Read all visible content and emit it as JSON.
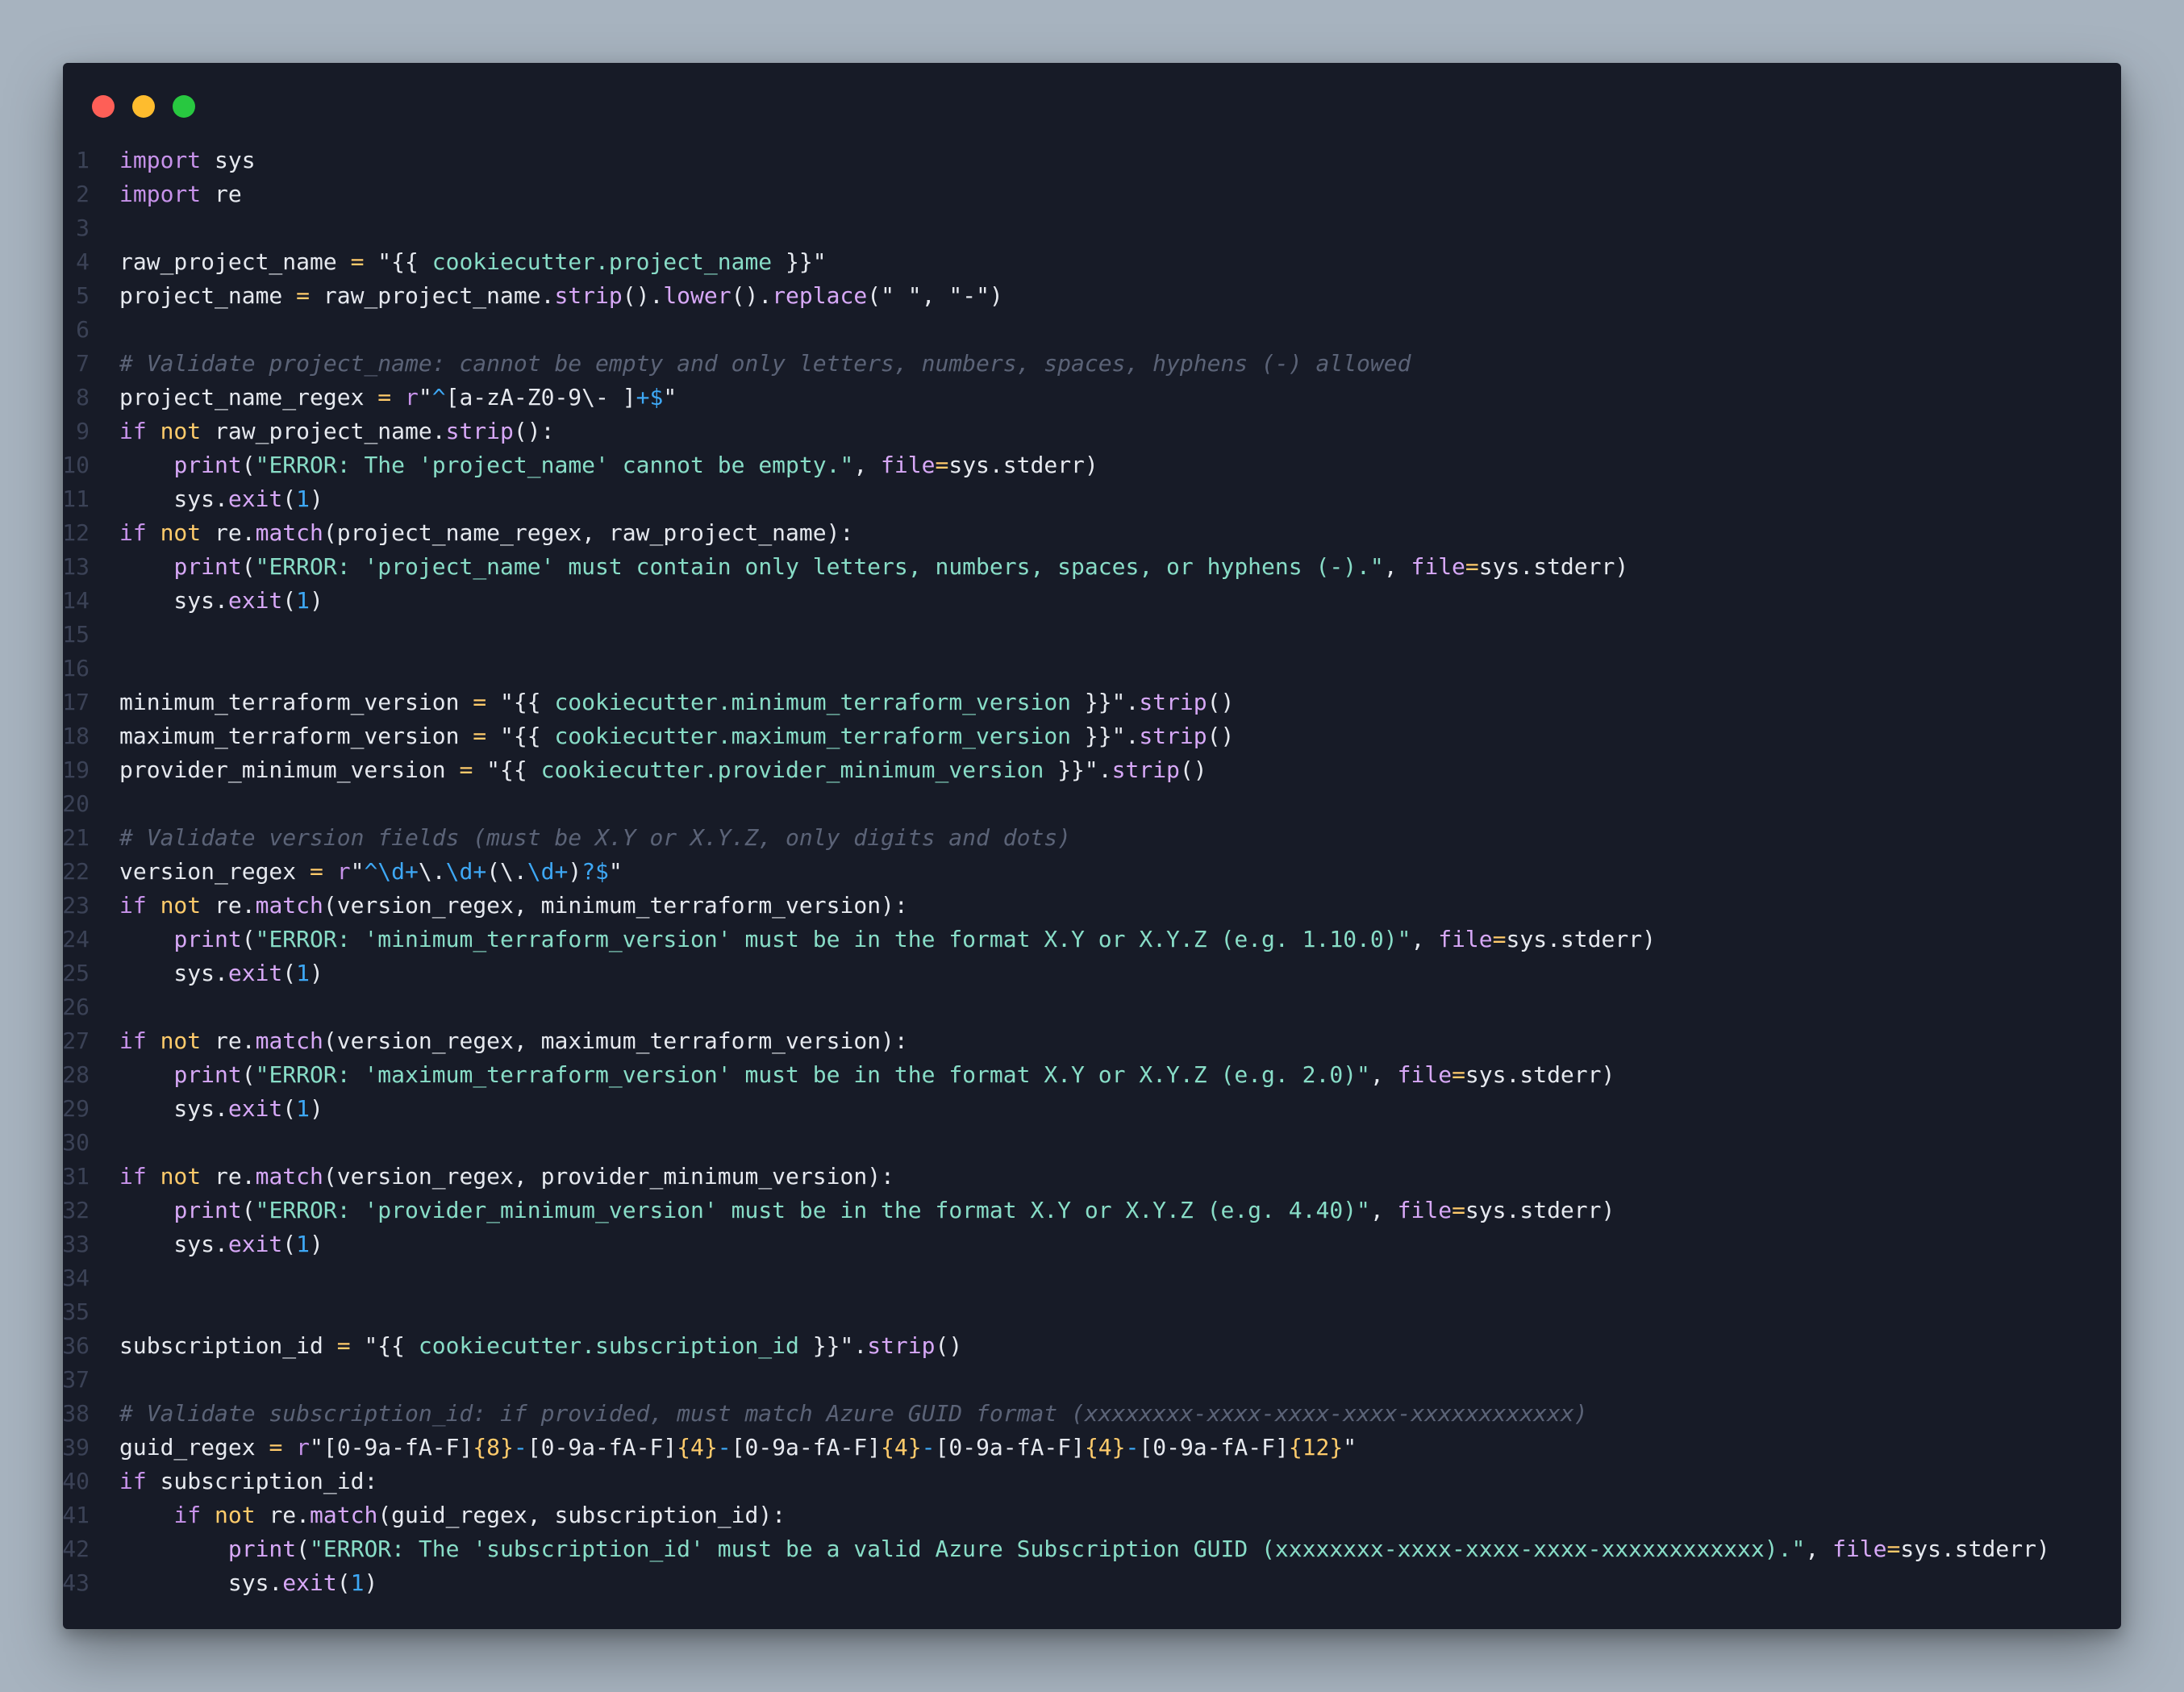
{
  "window": {
    "controls": [
      "close",
      "minimize",
      "maximize"
    ],
    "colors": {
      "close": "#fe5f57",
      "minimize": "#febc2e",
      "maximize": "#28c840",
      "background": "#171b27"
    }
  },
  "editor": {
    "language": "python",
    "lines": [
      {
        "n": "1",
        "tokens": [
          [
            "kw",
            "import"
          ],
          [
            "pl",
            " sys"
          ]
        ]
      },
      {
        "n": "2",
        "tokens": [
          [
            "kw",
            "import"
          ],
          [
            "pl",
            " re"
          ]
        ]
      },
      {
        "n": "3",
        "tokens": []
      },
      {
        "n": "4",
        "tokens": [
          [
            "pl",
            "raw_project_name "
          ],
          [
            "op",
            "="
          ],
          [
            "pl",
            " "
          ],
          [
            "strq",
            "\"{{"
          ],
          [
            "str",
            " cookiecutter.project_name "
          ],
          [
            "strq",
            "}}\""
          ]
        ]
      },
      {
        "n": "5",
        "tokens": [
          [
            "pl",
            "project_name "
          ],
          [
            "op",
            "="
          ],
          [
            "pl",
            " raw_project_name."
          ],
          [
            "fn",
            "strip"
          ],
          [
            "pl",
            "()."
          ],
          [
            "fn",
            "lower"
          ],
          [
            "pl",
            "()."
          ],
          [
            "fn",
            "replace"
          ],
          [
            "pl",
            "(\" \", \"-\")"
          ]
        ]
      },
      {
        "n": "6",
        "tokens": []
      },
      {
        "n": "7",
        "tokens": [
          [
            "cm",
            "# Validate project_name: cannot be empty and only letters, numbers, spaces, hyphens (-) allowed"
          ]
        ]
      },
      {
        "n": "8",
        "tokens": [
          [
            "pl",
            "project_name_regex "
          ],
          [
            "op",
            "="
          ],
          [
            "pl",
            " "
          ],
          [
            "kw",
            "r"
          ],
          [
            "strq",
            "\""
          ],
          [
            "rx",
            "^"
          ],
          [
            "strq",
            "[a-zA-Z0-9\\- ]"
          ],
          [
            "rx",
            "+$"
          ],
          [
            "strq",
            "\""
          ]
        ]
      },
      {
        "n": "9",
        "tokens": [
          [
            "kw",
            "if"
          ],
          [
            "pl",
            " "
          ],
          [
            "kw2",
            "not"
          ],
          [
            "pl",
            " raw_project_name."
          ],
          [
            "fn",
            "strip"
          ],
          [
            "pl",
            "():"
          ]
        ]
      },
      {
        "n": "10",
        "tokens": [
          [
            "pl",
            "    "
          ],
          [
            "fn",
            "print"
          ],
          [
            "pl",
            "("
          ],
          [
            "str",
            "\"ERROR: The 'project_name' cannot be empty.\""
          ],
          [
            "pl",
            ", "
          ],
          [
            "fn",
            "file"
          ],
          [
            "op",
            "="
          ],
          [
            "pl",
            "sys.stderr)"
          ]
        ]
      },
      {
        "n": "11",
        "tokens": [
          [
            "pl",
            "    sys."
          ],
          [
            "fn",
            "exit"
          ],
          [
            "pl",
            "("
          ],
          [
            "num",
            "1"
          ],
          [
            "pl",
            ")"
          ]
        ]
      },
      {
        "n": "12",
        "tokens": [
          [
            "kw",
            "if"
          ],
          [
            "pl",
            " "
          ],
          [
            "kw2",
            "not"
          ],
          [
            "pl",
            " re."
          ],
          [
            "fn",
            "match"
          ],
          [
            "pl",
            "(project_name_regex, raw_project_name):"
          ]
        ]
      },
      {
        "n": "13",
        "tokens": [
          [
            "pl",
            "    "
          ],
          [
            "fn",
            "print"
          ],
          [
            "pl",
            "("
          ],
          [
            "str",
            "\"ERROR: 'project_name' must contain only letters, numbers, spaces, or hyphens (-).\""
          ],
          [
            "pl",
            ", "
          ],
          [
            "fn",
            "file"
          ],
          [
            "op",
            "="
          ],
          [
            "pl",
            "sys.stderr)"
          ]
        ]
      },
      {
        "n": "14",
        "tokens": [
          [
            "pl",
            "    sys."
          ],
          [
            "fn",
            "exit"
          ],
          [
            "pl",
            "("
          ],
          [
            "num",
            "1"
          ],
          [
            "pl",
            ")"
          ]
        ]
      },
      {
        "n": "15",
        "tokens": []
      },
      {
        "n": "16",
        "tokens": []
      },
      {
        "n": "17",
        "tokens": [
          [
            "pl",
            "minimum_terraform_version "
          ],
          [
            "op",
            "="
          ],
          [
            "pl",
            " "
          ],
          [
            "strq",
            "\"{{"
          ],
          [
            "str",
            " cookiecutter.minimum_terraform_version "
          ],
          [
            "strq",
            "}}\""
          ],
          [
            "pl",
            "."
          ],
          [
            "fn",
            "strip"
          ],
          [
            "pl",
            "()"
          ]
        ]
      },
      {
        "n": "18",
        "tokens": [
          [
            "pl",
            "maximum_terraform_version "
          ],
          [
            "op",
            "="
          ],
          [
            "pl",
            " "
          ],
          [
            "strq",
            "\"{{"
          ],
          [
            "str",
            " cookiecutter.maximum_terraform_version "
          ],
          [
            "strq",
            "}}\""
          ],
          [
            "pl",
            "."
          ],
          [
            "fn",
            "strip"
          ],
          [
            "pl",
            "()"
          ]
        ]
      },
      {
        "n": "19",
        "tokens": [
          [
            "pl",
            "provider_minimum_version "
          ],
          [
            "op",
            "="
          ],
          [
            "pl",
            " "
          ],
          [
            "strq",
            "\"{{"
          ],
          [
            "str",
            " cookiecutter.provider_minimum_version "
          ],
          [
            "strq",
            "}}\""
          ],
          [
            "pl",
            "."
          ],
          [
            "fn",
            "strip"
          ],
          [
            "pl",
            "()"
          ]
        ]
      },
      {
        "n": "20",
        "tokens": []
      },
      {
        "n": "21",
        "tokens": [
          [
            "cm",
            "# Validate version fields (must be X.Y or X.Y.Z, only digits and dots)"
          ]
        ]
      },
      {
        "n": "22",
        "tokens": [
          [
            "pl",
            "version_regex "
          ],
          [
            "op",
            "="
          ],
          [
            "pl",
            " "
          ],
          [
            "kw",
            "r"
          ],
          [
            "strq",
            "\""
          ],
          [
            "rx",
            "^\\d+"
          ],
          [
            "strq",
            "\\."
          ],
          [
            "rx",
            "\\d+"
          ],
          [
            "strq",
            "(\\."
          ],
          [
            "rx",
            "\\d+"
          ],
          [
            "strq",
            ")"
          ],
          [
            "rx",
            "?$"
          ],
          [
            "strq",
            "\""
          ]
        ]
      },
      {
        "n": "23",
        "tokens": [
          [
            "kw",
            "if"
          ],
          [
            "pl",
            " "
          ],
          [
            "kw2",
            "not"
          ],
          [
            "pl",
            " re."
          ],
          [
            "fn",
            "match"
          ],
          [
            "pl",
            "(version_regex, minimum_terraform_version):"
          ]
        ]
      },
      {
        "n": "24",
        "tokens": [
          [
            "pl",
            "    "
          ],
          [
            "fn",
            "print"
          ],
          [
            "pl",
            "("
          ],
          [
            "str",
            "\"ERROR: 'minimum_terraform_version' must be in the format X.Y or X.Y.Z (e.g. 1.10.0)\""
          ],
          [
            "pl",
            ", "
          ],
          [
            "fn",
            "file"
          ],
          [
            "op",
            "="
          ],
          [
            "pl",
            "sys.stderr)"
          ]
        ]
      },
      {
        "n": "25",
        "tokens": [
          [
            "pl",
            "    sys."
          ],
          [
            "fn",
            "exit"
          ],
          [
            "pl",
            "("
          ],
          [
            "num",
            "1"
          ],
          [
            "pl",
            ")"
          ]
        ]
      },
      {
        "n": "26",
        "tokens": []
      },
      {
        "n": "27",
        "tokens": [
          [
            "kw",
            "if"
          ],
          [
            "pl",
            " "
          ],
          [
            "kw2",
            "not"
          ],
          [
            "pl",
            " re."
          ],
          [
            "fn",
            "match"
          ],
          [
            "pl",
            "(version_regex, maximum_terraform_version):"
          ]
        ]
      },
      {
        "n": "28",
        "tokens": [
          [
            "pl",
            "    "
          ],
          [
            "fn",
            "print"
          ],
          [
            "pl",
            "("
          ],
          [
            "str",
            "\"ERROR: 'maximum_terraform_version' must be in the format X.Y or X.Y.Z (e.g. 2.0)\""
          ],
          [
            "pl",
            ", "
          ],
          [
            "fn",
            "file"
          ],
          [
            "op",
            "="
          ],
          [
            "pl",
            "sys.stderr)"
          ]
        ]
      },
      {
        "n": "29",
        "tokens": [
          [
            "pl",
            "    sys."
          ],
          [
            "fn",
            "exit"
          ],
          [
            "pl",
            "("
          ],
          [
            "num",
            "1"
          ],
          [
            "pl",
            ")"
          ]
        ]
      },
      {
        "n": "30",
        "tokens": []
      },
      {
        "n": "31",
        "tokens": [
          [
            "kw",
            "if"
          ],
          [
            "pl",
            " "
          ],
          [
            "kw2",
            "not"
          ],
          [
            "pl",
            " re."
          ],
          [
            "fn",
            "match"
          ],
          [
            "pl",
            "(version_regex, provider_minimum_version):"
          ]
        ]
      },
      {
        "n": "32",
        "tokens": [
          [
            "pl",
            "    "
          ],
          [
            "fn",
            "print"
          ],
          [
            "pl",
            "("
          ],
          [
            "str",
            "\"ERROR: 'provider_minimum_version' must be in the format X.Y or X.Y.Z (e.g. 4.40)\""
          ],
          [
            "pl",
            ", "
          ],
          [
            "fn",
            "file"
          ],
          [
            "op",
            "="
          ],
          [
            "pl",
            "sys.stderr)"
          ]
        ]
      },
      {
        "n": "33",
        "tokens": [
          [
            "pl",
            "    sys."
          ],
          [
            "fn",
            "exit"
          ],
          [
            "pl",
            "("
          ],
          [
            "num",
            "1"
          ],
          [
            "pl",
            ")"
          ]
        ]
      },
      {
        "n": "34",
        "tokens": []
      },
      {
        "n": "35",
        "tokens": []
      },
      {
        "n": "36",
        "tokens": [
          [
            "pl",
            "subscription_id "
          ],
          [
            "op",
            "="
          ],
          [
            "pl",
            " "
          ],
          [
            "strq",
            "\"{{"
          ],
          [
            "str",
            " cookiecutter.subscription_id "
          ],
          [
            "strq",
            "}}\""
          ],
          [
            "pl",
            "."
          ],
          [
            "fn",
            "strip"
          ],
          [
            "pl",
            "()"
          ]
        ]
      },
      {
        "n": "37",
        "tokens": []
      },
      {
        "n": "38",
        "tokens": [
          [
            "cm",
            "# Validate subscription_id: if provided, must match Azure GUID format (xxxxxxxx-xxxx-xxxx-xxxx-xxxxxxxxxxxx)"
          ]
        ]
      },
      {
        "n": "39",
        "tokens": [
          [
            "pl",
            "guid_regex "
          ],
          [
            "op",
            "="
          ],
          [
            "pl",
            " "
          ],
          [
            "kw",
            "r"
          ],
          [
            "strq",
            "\"[0-9a-fA-F]"
          ],
          [
            "rxq",
            "{8}"
          ],
          [
            "rx",
            "-"
          ],
          [
            "strq",
            "[0-9a-fA-F]"
          ],
          [
            "rxq",
            "{4}"
          ],
          [
            "rx",
            "-"
          ],
          [
            "strq",
            "[0-9a-fA-F]"
          ],
          [
            "rxq",
            "{4}"
          ],
          [
            "rx",
            "-"
          ],
          [
            "strq",
            "[0-9a-fA-F]"
          ],
          [
            "rxq",
            "{4}"
          ],
          [
            "rx",
            "-"
          ],
          [
            "strq",
            "[0-9a-fA-F]"
          ],
          [
            "rxq",
            "{12}"
          ],
          [
            "strq",
            "\""
          ]
        ]
      },
      {
        "n": "40",
        "tokens": [
          [
            "kw",
            "if"
          ],
          [
            "pl",
            " subscription_id:"
          ]
        ]
      },
      {
        "n": "41",
        "tokens": [
          [
            "pl",
            "    "
          ],
          [
            "kw",
            "if"
          ],
          [
            "pl",
            " "
          ],
          [
            "kw2",
            "not"
          ],
          [
            "pl",
            " re."
          ],
          [
            "fn",
            "match"
          ],
          [
            "pl",
            "(guid_regex, subscription_id):"
          ]
        ]
      },
      {
        "n": "42",
        "tokens": [
          [
            "pl",
            "        "
          ],
          [
            "fn",
            "print"
          ],
          [
            "pl",
            "("
          ],
          [
            "str",
            "\"ERROR: The 'subscription_id' must be a valid Azure Subscription GUID (xxxxxxxx-xxxx-xxxx-xxxx-xxxxxxxxxxxx).\""
          ],
          [
            "pl",
            ", "
          ],
          [
            "fn",
            "file"
          ],
          [
            "op",
            "="
          ],
          [
            "pl",
            "sys.stderr)"
          ]
        ]
      },
      {
        "n": "43",
        "tokens": [
          [
            "pl",
            "        sys."
          ],
          [
            "fn",
            "exit"
          ],
          [
            "pl",
            "("
          ],
          [
            "num",
            "1"
          ],
          [
            "pl",
            ")"
          ]
        ]
      }
    ]
  }
}
